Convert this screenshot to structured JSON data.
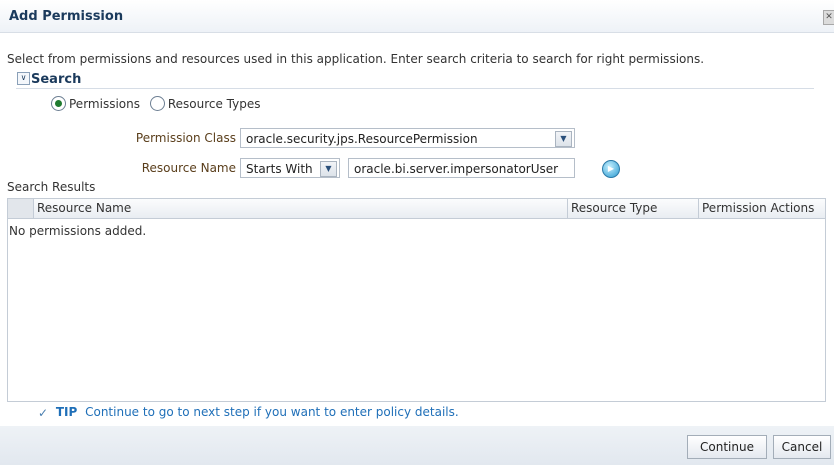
{
  "dialog": {
    "title": "Add Permission",
    "description": "Select from permissions and resources used in this application. Enter search criteria to search for right permissions.",
    "close_icon": "close-icon"
  },
  "search": {
    "header": "Search",
    "radio_permissions": "Permissions",
    "radio_resource_types": "Resource Types",
    "selected_radio": "Permissions",
    "permission_class_label": "Permission Class",
    "permission_class_value": "oracle.security.jps.ResourcePermission",
    "resource_name_label": "Resource Name",
    "resource_name_operator": "Starts With",
    "resource_name_value": "oracle.bi.server.impersonatorUser"
  },
  "results": {
    "label": "Search Results",
    "columns": [
      "Resource Name",
      "Resource Type",
      "Permission Actions"
    ],
    "empty_message": "No permissions added."
  },
  "tip": {
    "label": "TIP",
    "text": "Continue to go to next step if you want to enter policy details."
  },
  "footer": {
    "continue_label": "Continue",
    "cancel_label": "Cancel"
  },
  "colors": {
    "title": "#1b3a5c",
    "tip": "#1f6fb8",
    "label": "#5a3e1b"
  }
}
